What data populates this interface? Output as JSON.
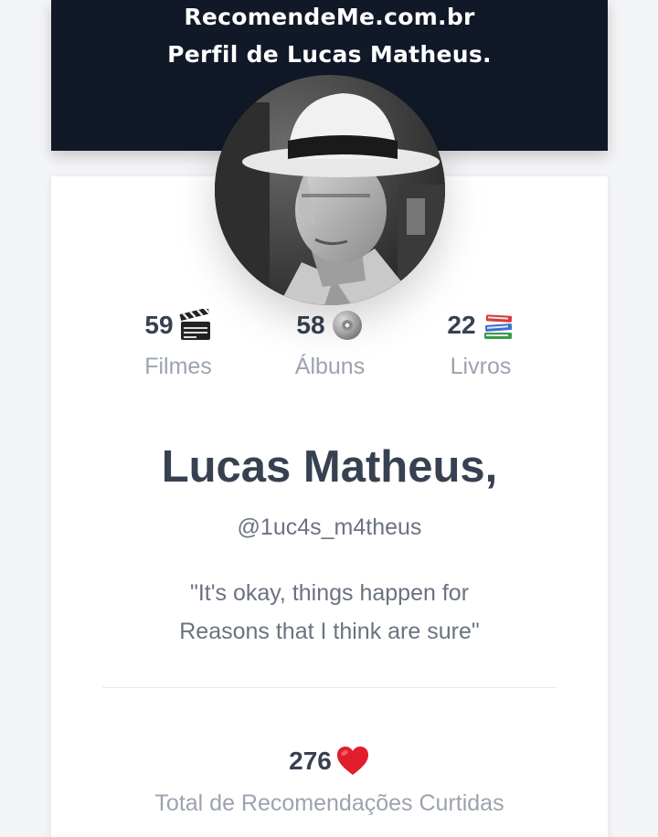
{
  "header": {
    "site": "RecomendeMe.com.br",
    "subtitle": "Perfil de Lucas Matheus."
  },
  "profile": {
    "name": "Lucas Matheus,",
    "handle": "@1uc4s_m4theus",
    "bio_line1": "\"It's okay, things happen for",
    "bio_line2": "Reasons that I think are sure\""
  },
  "stats": [
    {
      "count": "59",
      "icon": "clapperboard-icon",
      "label": "Filmes"
    },
    {
      "count": "58",
      "icon": "disc-icon",
      "label": "Álbuns"
    },
    {
      "count": "22",
      "icon": "books-icon",
      "label": "Livros"
    }
  ],
  "likes": {
    "count": "276",
    "icon": "heart-icon",
    "label": "Total de Recomendações Curtidas"
  },
  "colors": {
    "header_bg": "#111827",
    "text_dark": "#374151",
    "text_muted": "#9ca3af",
    "heart": "#e11d2e"
  }
}
